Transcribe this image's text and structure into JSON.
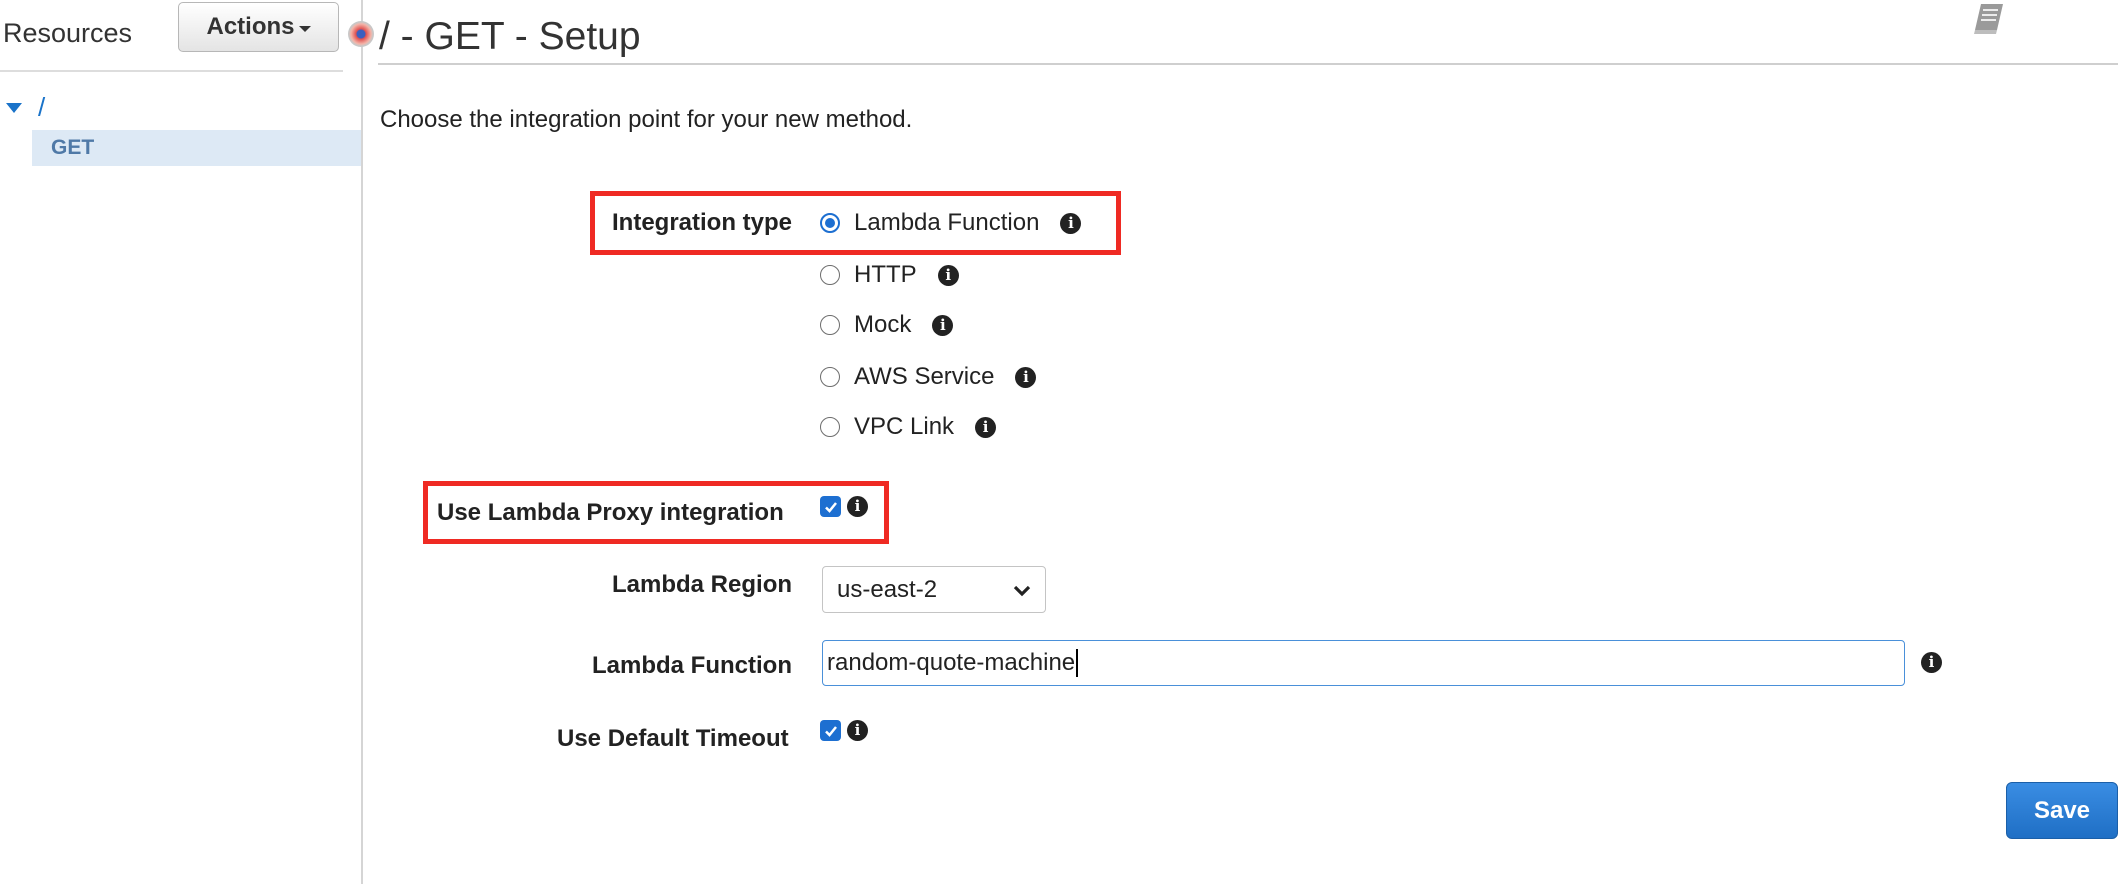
{
  "sidebar": {
    "title": "Resources",
    "actions_label": "Actions",
    "tree": {
      "root_label": "/",
      "child_label": "GET"
    }
  },
  "header": {
    "title": "/ - GET - Setup"
  },
  "form": {
    "intro": "Choose the integration point for your new method.",
    "integration_type": {
      "label": "Integration type",
      "options": [
        {
          "label": "Lambda Function",
          "selected": true
        },
        {
          "label": "HTTP",
          "selected": false
        },
        {
          "label": "Mock",
          "selected": false
        },
        {
          "label": "AWS Service",
          "selected": false
        },
        {
          "label": "VPC Link",
          "selected": false
        }
      ]
    },
    "proxy": {
      "label": "Use Lambda Proxy integration",
      "checked": true
    },
    "region": {
      "label": "Lambda Region",
      "value": "us-east-2"
    },
    "function": {
      "label": "Lambda Function",
      "value": "random-quote-machine"
    },
    "timeout": {
      "label": "Use Default Timeout",
      "checked": true
    },
    "save_label": "Save"
  },
  "icons": {
    "info": "info-icon",
    "docs": "book-icon",
    "expand": "triangle-down-icon",
    "select": "chevron-down-icon"
  },
  "colors": {
    "accent": "#1d6fd1",
    "highlight_box": "#ef2a23",
    "selected_row": "#dde9f5"
  }
}
